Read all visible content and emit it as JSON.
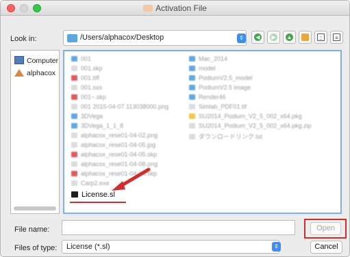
{
  "window": {
    "title": "Activation File"
  },
  "lookin": {
    "label": "Look in:",
    "path": "/Users/alphacox/Desktop"
  },
  "places": [
    {
      "label": "Computer",
      "icon": "computer-icon"
    },
    {
      "label": "alphacox",
      "icon": "home-icon"
    }
  ],
  "files": {
    "left": [
      {
        "name": "001",
        "icon": "folder"
      },
      {
        "name": "001.skp",
        "icon": "doc"
      },
      {
        "name": "001.tiff",
        "icon": "red"
      },
      {
        "name": "001.sxs",
        "icon": "doc"
      },
      {
        "name": "001~.skp",
        "icon": "red"
      },
      {
        "name": "001 2015-04-07 113038000.png",
        "icon": "doc"
      },
      {
        "name": "3DVega",
        "icon": "folder"
      },
      {
        "name": "3DVega_1_1_8",
        "icon": "folder"
      },
      {
        "name": "alphacox_rese01-04-02.png",
        "icon": "doc"
      },
      {
        "name": "alphacox_rese01-04-05.jpg",
        "icon": "doc"
      },
      {
        "name": "alphacox_rese01-04-05.skp",
        "icon": "red"
      },
      {
        "name": "alphacox_rese01-04-08.png",
        "icon": "doc"
      },
      {
        "name": "alphacox_rese01-04-08.skp",
        "icon": "red"
      },
      {
        "name": "Carp2.exe",
        "icon": "doc"
      }
    ],
    "right": [
      {
        "name": "Mac_2014",
        "icon": "folder"
      },
      {
        "name": "model",
        "icon": "folder"
      },
      {
        "name": "PodiumV2.5_model",
        "icon": "folder"
      },
      {
        "name": "PodiumV2.5 image",
        "icon": "folder"
      },
      {
        "name": "Render46",
        "icon": "folder"
      },
      {
        "name": "Simlab_PDF01.tif",
        "icon": "doc"
      },
      {
        "name": "SU2014_Podium_V2_5_002_x64.pkg",
        "icon": "yellow"
      },
      {
        "name": "SU2014_Podium_V2_5_002_x64.pkg.zip",
        "icon": "doc"
      },
      {
        "name": "ダウンロードリンク.txt",
        "icon": "doc"
      }
    ],
    "highlighted": "License.sl"
  },
  "filename": {
    "label": "File name:",
    "value": ""
  },
  "filetype": {
    "label": "Files of type:",
    "value": "License (*.sl)"
  },
  "buttons": {
    "open": "Open",
    "cancel": "Cancel"
  },
  "colors": {
    "accent": "#3d8ef0",
    "annotation": "#d42b2b",
    "folder": "#62a9e2",
    "selection_border": "#7db0e8"
  }
}
